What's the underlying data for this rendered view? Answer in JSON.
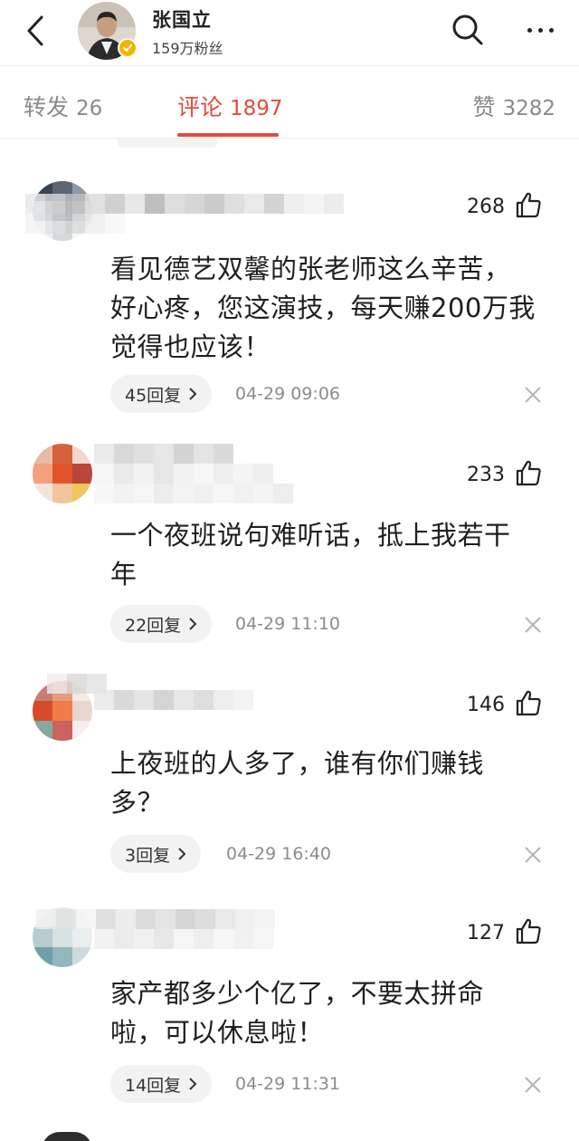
{
  "header": {
    "user_name": "张国立",
    "followers": "159万粉丝",
    "colors": {
      "verified": "#f4b400"
    }
  },
  "tabs": [
    {
      "label": "转发",
      "count": "26",
      "active": false
    },
    {
      "label": "评论",
      "count": "1897",
      "active": true
    },
    {
      "label": "赞",
      "count": "3282",
      "active": false
    }
  ],
  "accent_color": "#e64a3a",
  "comments": [
    {
      "likes": "268",
      "text_lines": [
        "看见德艺双馨的张老师这么辛苦，",
        "好心疼，您这演技，每天赚200万我",
        "觉得也应该！"
      ],
      "reply_label": "45回复",
      "time": "04-29  09:06"
    },
    {
      "likes": "233",
      "text_lines": [
        "一个夜班说句难听话，抵上我若干",
        "年"
      ],
      "reply_label": "22回复",
      "time": "04-29  11:10"
    },
    {
      "likes": "146",
      "text_lines": [
        "上夜班的人多了，谁有你们赚钱",
        "多？"
      ],
      "reply_label": "3回复",
      "time": "04-29  16:40"
    },
    {
      "likes": "127",
      "text_lines": [
        "家产都多少个亿了，不要太拼命",
        "啦，可以休息啦！"
      ],
      "reply_label": "14回复",
      "time": "04-29  11:31"
    }
  ],
  "icons": {
    "back": "chevron-left-icon",
    "search": "search-icon",
    "more": "more-dots-icon",
    "verified": "verified-badge-icon",
    "like": "thumbs-up-icon",
    "reply_arrow": "chevron-right-icon",
    "dismiss": "close-icon"
  }
}
